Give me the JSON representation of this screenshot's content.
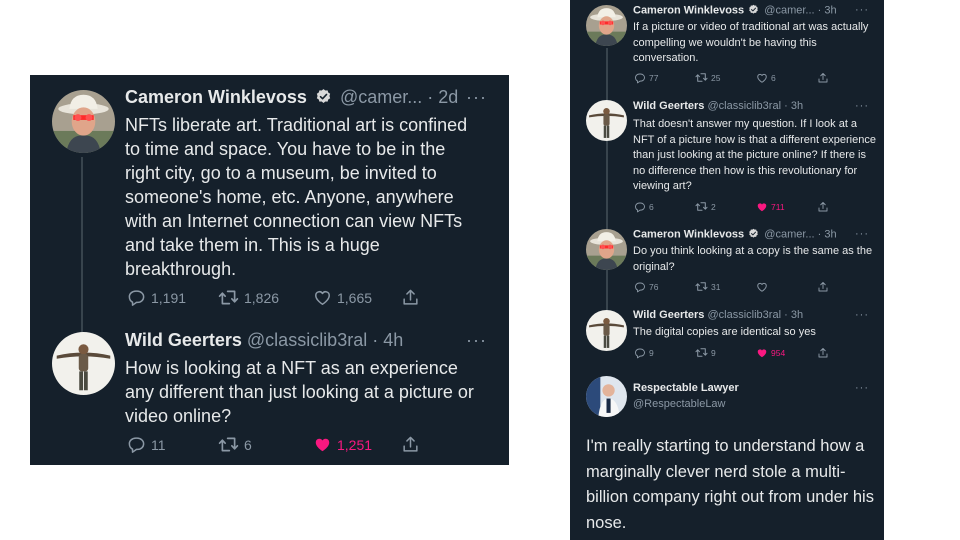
{
  "left": {
    "tweet1": {
      "name": "Cameron Winklevoss",
      "handle": "@camer...",
      "sep": "·",
      "time": "2d",
      "text": "NFTs liberate art. Traditional art is confined to time and space. You have to be in the right city, go to a museum, be invited to someone's home, etc. Anyone, anywhere with an Internet connection can view NFTs and take them in. This is a huge breakthrough.",
      "replies": "1,191",
      "retweets": "1,826",
      "likes": "1,665",
      "more": "···"
    },
    "tweet2": {
      "name": "Wild Geerters",
      "handle": "@classiclib3ral",
      "sep": "·",
      "time": "4h",
      "text": "How is looking at a NFT as an experience any different than just looking at a picture or video online?",
      "replies": "11",
      "retweets": "6",
      "likes": "1,251",
      "more": "···"
    }
  },
  "right": {
    "tweet1": {
      "name": "Cameron Winklevoss",
      "handle": "@camer...",
      "sep": "·",
      "time": "3h",
      "text": "If a picture or video of traditional art was actually compelling we wouldn't be having this conversation.",
      "replies": "77",
      "retweets": "25",
      "likes": "6",
      "more": "···"
    },
    "tweet2": {
      "name": "Wild Geerters",
      "handle": "@classiclib3ral",
      "sep": "·",
      "time": "3h",
      "text": "That doesn't answer my question. If I look at a NFT of a picture how is that a different experience than just looking at the picture online? If there is no difference then how is this revolutionary for viewing art?",
      "replies": "6",
      "retweets": "2",
      "likes": "711",
      "more": "···"
    },
    "tweet3": {
      "name": "Cameron Winklevoss",
      "handle": "@camer...",
      "sep": "·",
      "time": "3h",
      "text": "Do you think looking at a copy is the same as the original?",
      "replies": "76",
      "retweets": "31",
      "likes": "",
      "more": "···"
    },
    "tweet4": {
      "name": "Wild Geerters",
      "handle": "@classiclib3ral",
      "sep": "·",
      "time": "3h",
      "text": "The digital copies are identical so yes",
      "replies": "9",
      "retweets": "9",
      "likes": "954",
      "more": "···"
    },
    "tweet5": {
      "name": "Respectable Lawyer",
      "handle": "@RespectableLaw",
      "text": "I'm really starting to understand how a marginally clever nerd stole a multi-billion company right out from under his nose.",
      "more": "···"
    }
  },
  "icons": {
    "reply": "reply-icon",
    "retweet": "retweet-icon",
    "like": "heart-icon",
    "share": "share-icon",
    "verified": "verified-badge-icon"
  },
  "colors": {
    "background": "#15202b",
    "text": "#e7e9ea",
    "muted": "#8b98a5",
    "like": "#f91880",
    "verified": "#d9d9d9"
  }
}
